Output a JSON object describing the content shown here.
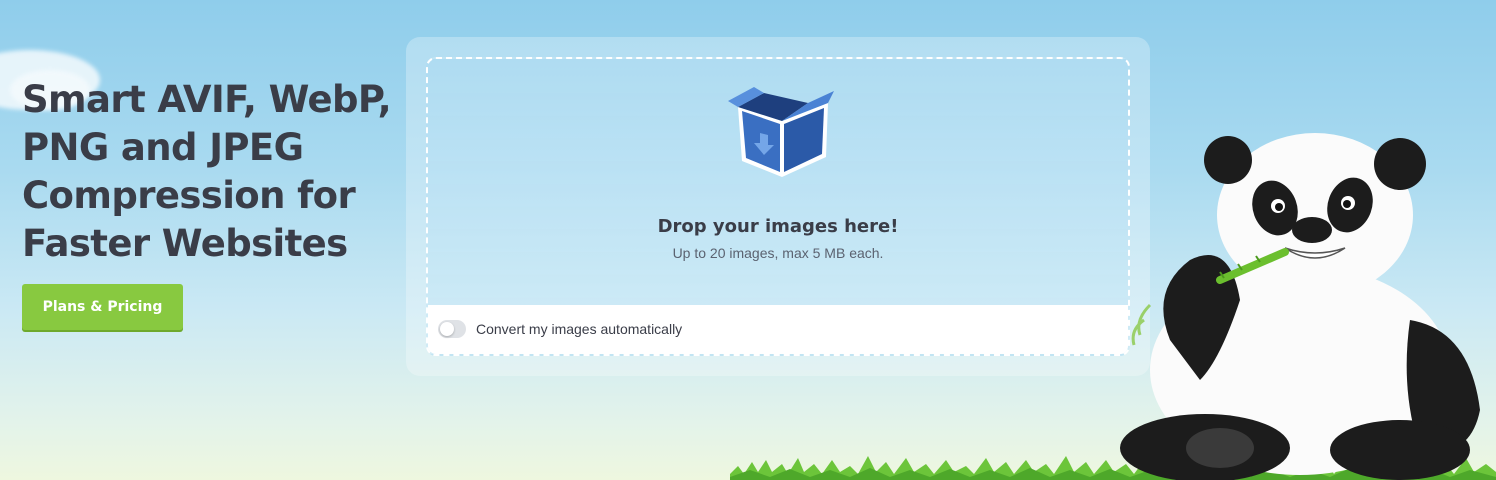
{
  "hero": {
    "title_lines": [
      "Smart AVIF, WebP,",
      "PNG and JPEG",
      "Compression for",
      "Faster Websites"
    ],
    "cta_label": "Plans & Pricing"
  },
  "dropzone": {
    "icon": "open-box-icon",
    "title": "Drop your images here!",
    "subtitle": "Up to 20 images, max 5 MB each.",
    "convert_label": "Convert my images automatically",
    "convert_enabled": false
  },
  "colors": {
    "accent_green": "#88c940",
    "text_dark": "#3a3d48",
    "sky": "#8fcdeb"
  },
  "mascot": "panda-mascot"
}
